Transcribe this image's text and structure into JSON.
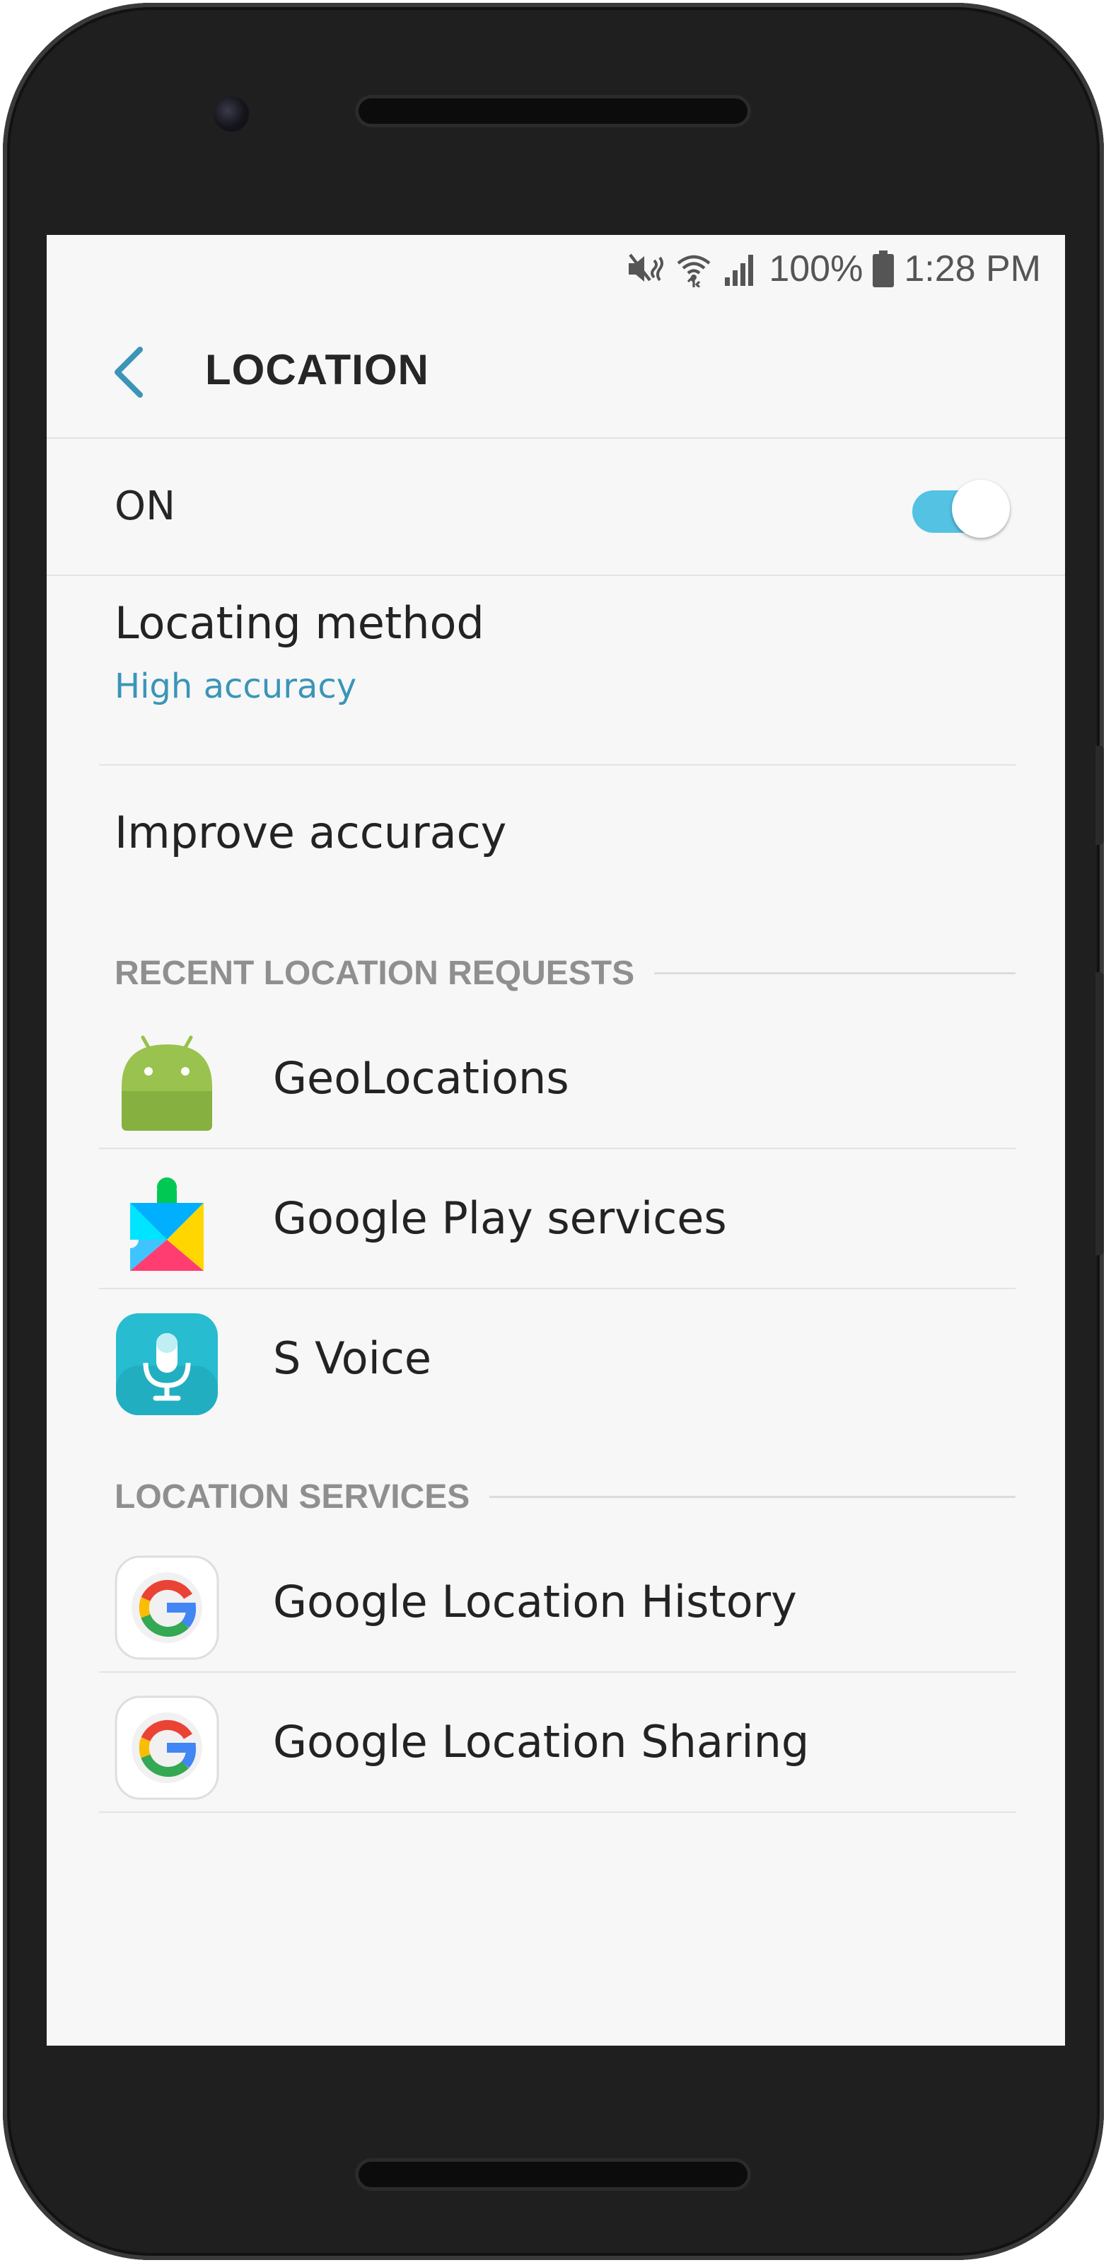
{
  "status_bar": {
    "battery": "100%",
    "time": "1:28 PM",
    "icons": [
      "mute-vibrate-icon",
      "wifi-icon",
      "signal-icon",
      "battery-icon"
    ]
  },
  "header": {
    "title": "LOCATION",
    "back_icon": "chevron-left-icon"
  },
  "master_toggle": {
    "label": "ON",
    "state": "on",
    "color": "#53c2e3"
  },
  "settings": {
    "locating_method": {
      "label": "Locating method",
      "value": "High accuracy"
    },
    "improve_accuracy": {
      "label": "Improve accuracy"
    }
  },
  "recent_requests": {
    "heading": "RECENT LOCATION REQUESTS",
    "items": [
      {
        "label": "GeoLocations",
        "icon": "android-icon"
      },
      {
        "label": "Google Play services",
        "icon": "google-play-services-icon"
      },
      {
        "label": "S Voice",
        "icon": "s-voice-icon"
      }
    ]
  },
  "location_services": {
    "heading": "LOCATION SERVICES",
    "items": [
      {
        "label": "Google Location History",
        "icon": "google-g-icon"
      },
      {
        "label": "Google Location Sharing",
        "icon": "google-g-icon"
      }
    ]
  },
  "colors": {
    "accent": "#3a95b8",
    "toggle": "#53c2e3",
    "section_heading": "#8f8f8f"
  }
}
